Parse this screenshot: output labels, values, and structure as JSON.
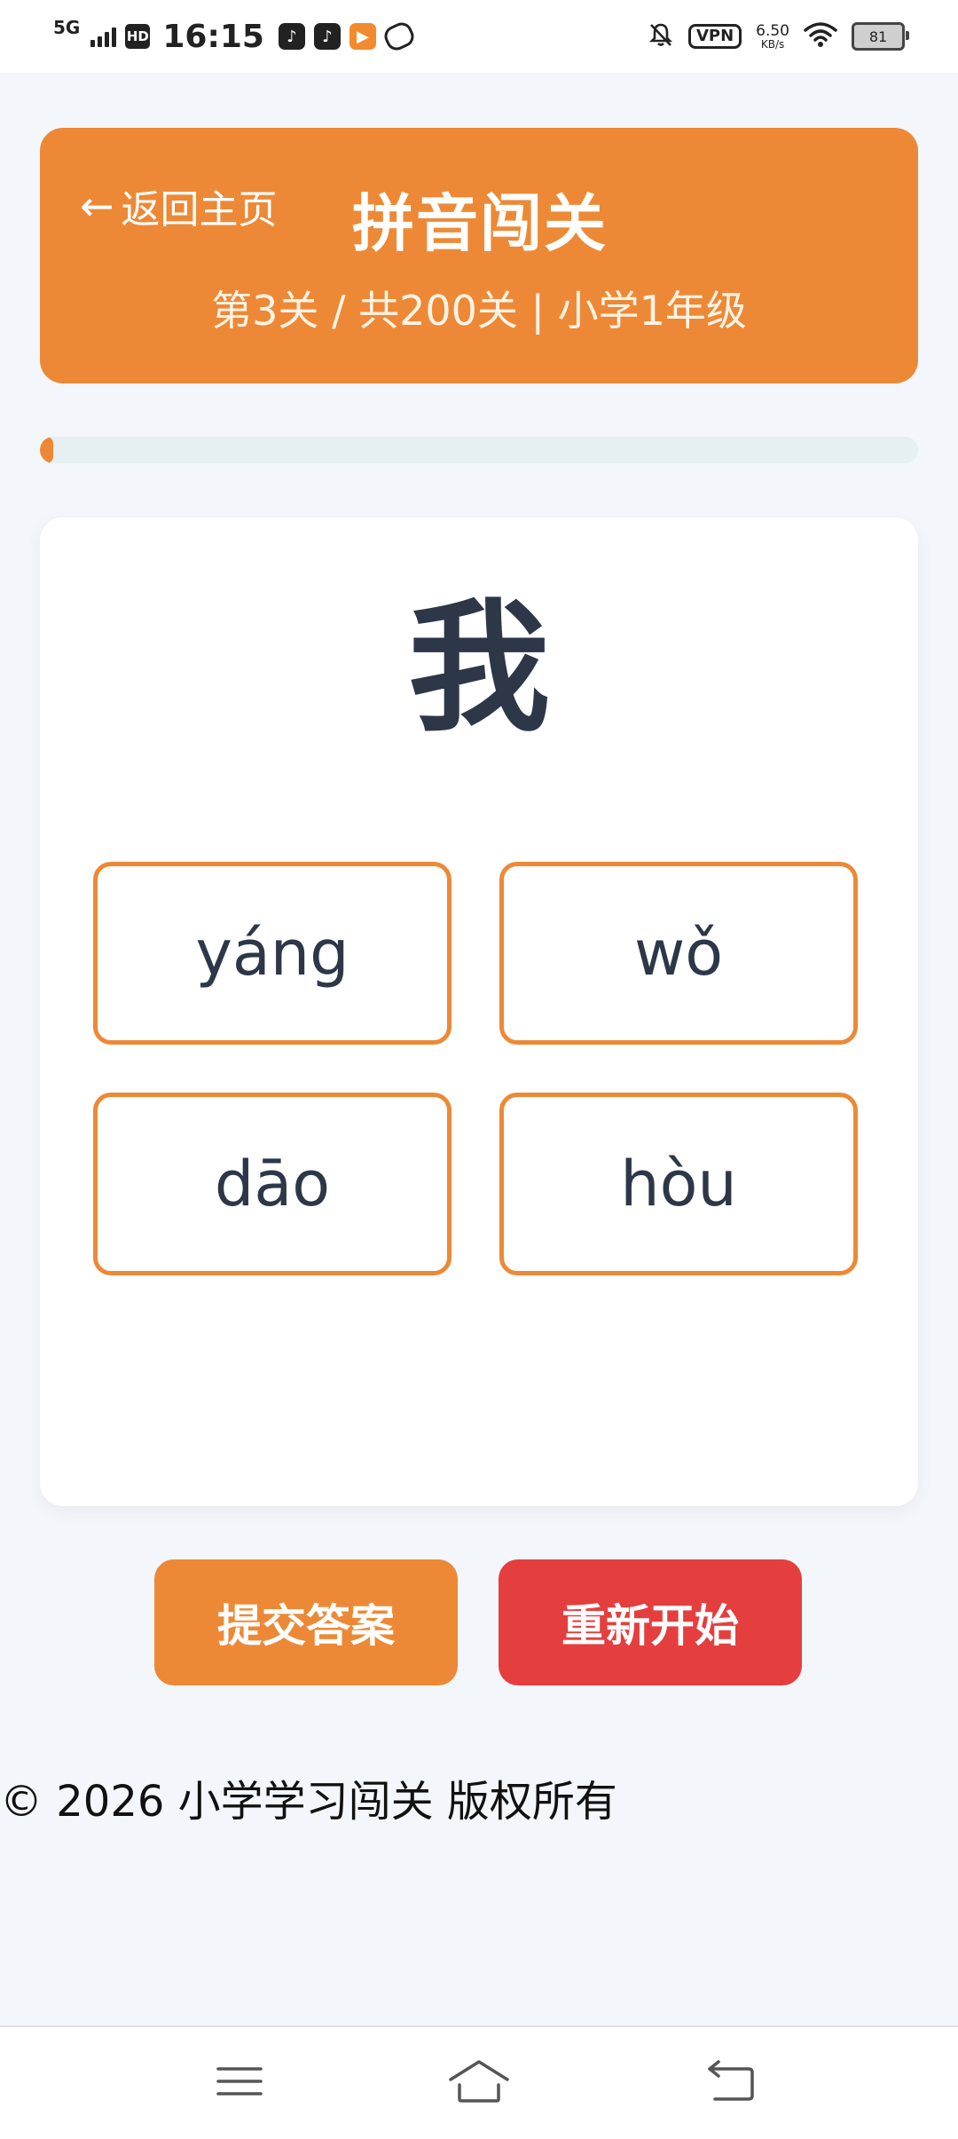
{
  "status_bar": {
    "network": "5G",
    "hd": "HD",
    "time": "16:15",
    "vpn": "VPN",
    "speed_value": "6.50",
    "speed_unit": "KB/s",
    "battery": "81",
    "icons": [
      "tiktok-icon",
      "tiktok-icon",
      "video-app-icon",
      "link-icon",
      "mute-bell-icon",
      "wifi-icon",
      "battery-icon"
    ]
  },
  "header": {
    "back_arrow": "←",
    "back_label": "返回主页",
    "title": "拼音闯关",
    "level_info": "第3关 / 共200关 | 小学1年级"
  },
  "progress": {
    "current_level": 3,
    "total_levels": 200,
    "fill_percent": 1.5,
    "color": "#ed8936"
  },
  "question": {
    "character": "我",
    "options": [
      "yáng",
      "wǒ",
      "dāo",
      "hòu"
    ]
  },
  "actions": {
    "submit_label": "提交答案",
    "restart_label": "重新开始"
  },
  "footer": {
    "copyright": "© 2026 小学学习闯关 版权所有"
  },
  "nav_bar": {
    "icons": [
      "menu-icon",
      "home-icon",
      "back-icon"
    ]
  },
  "colors": {
    "accent": "#ed8936",
    "danger": "#e53e3e",
    "background": "#f3f7fb",
    "text": "#2d3748"
  }
}
